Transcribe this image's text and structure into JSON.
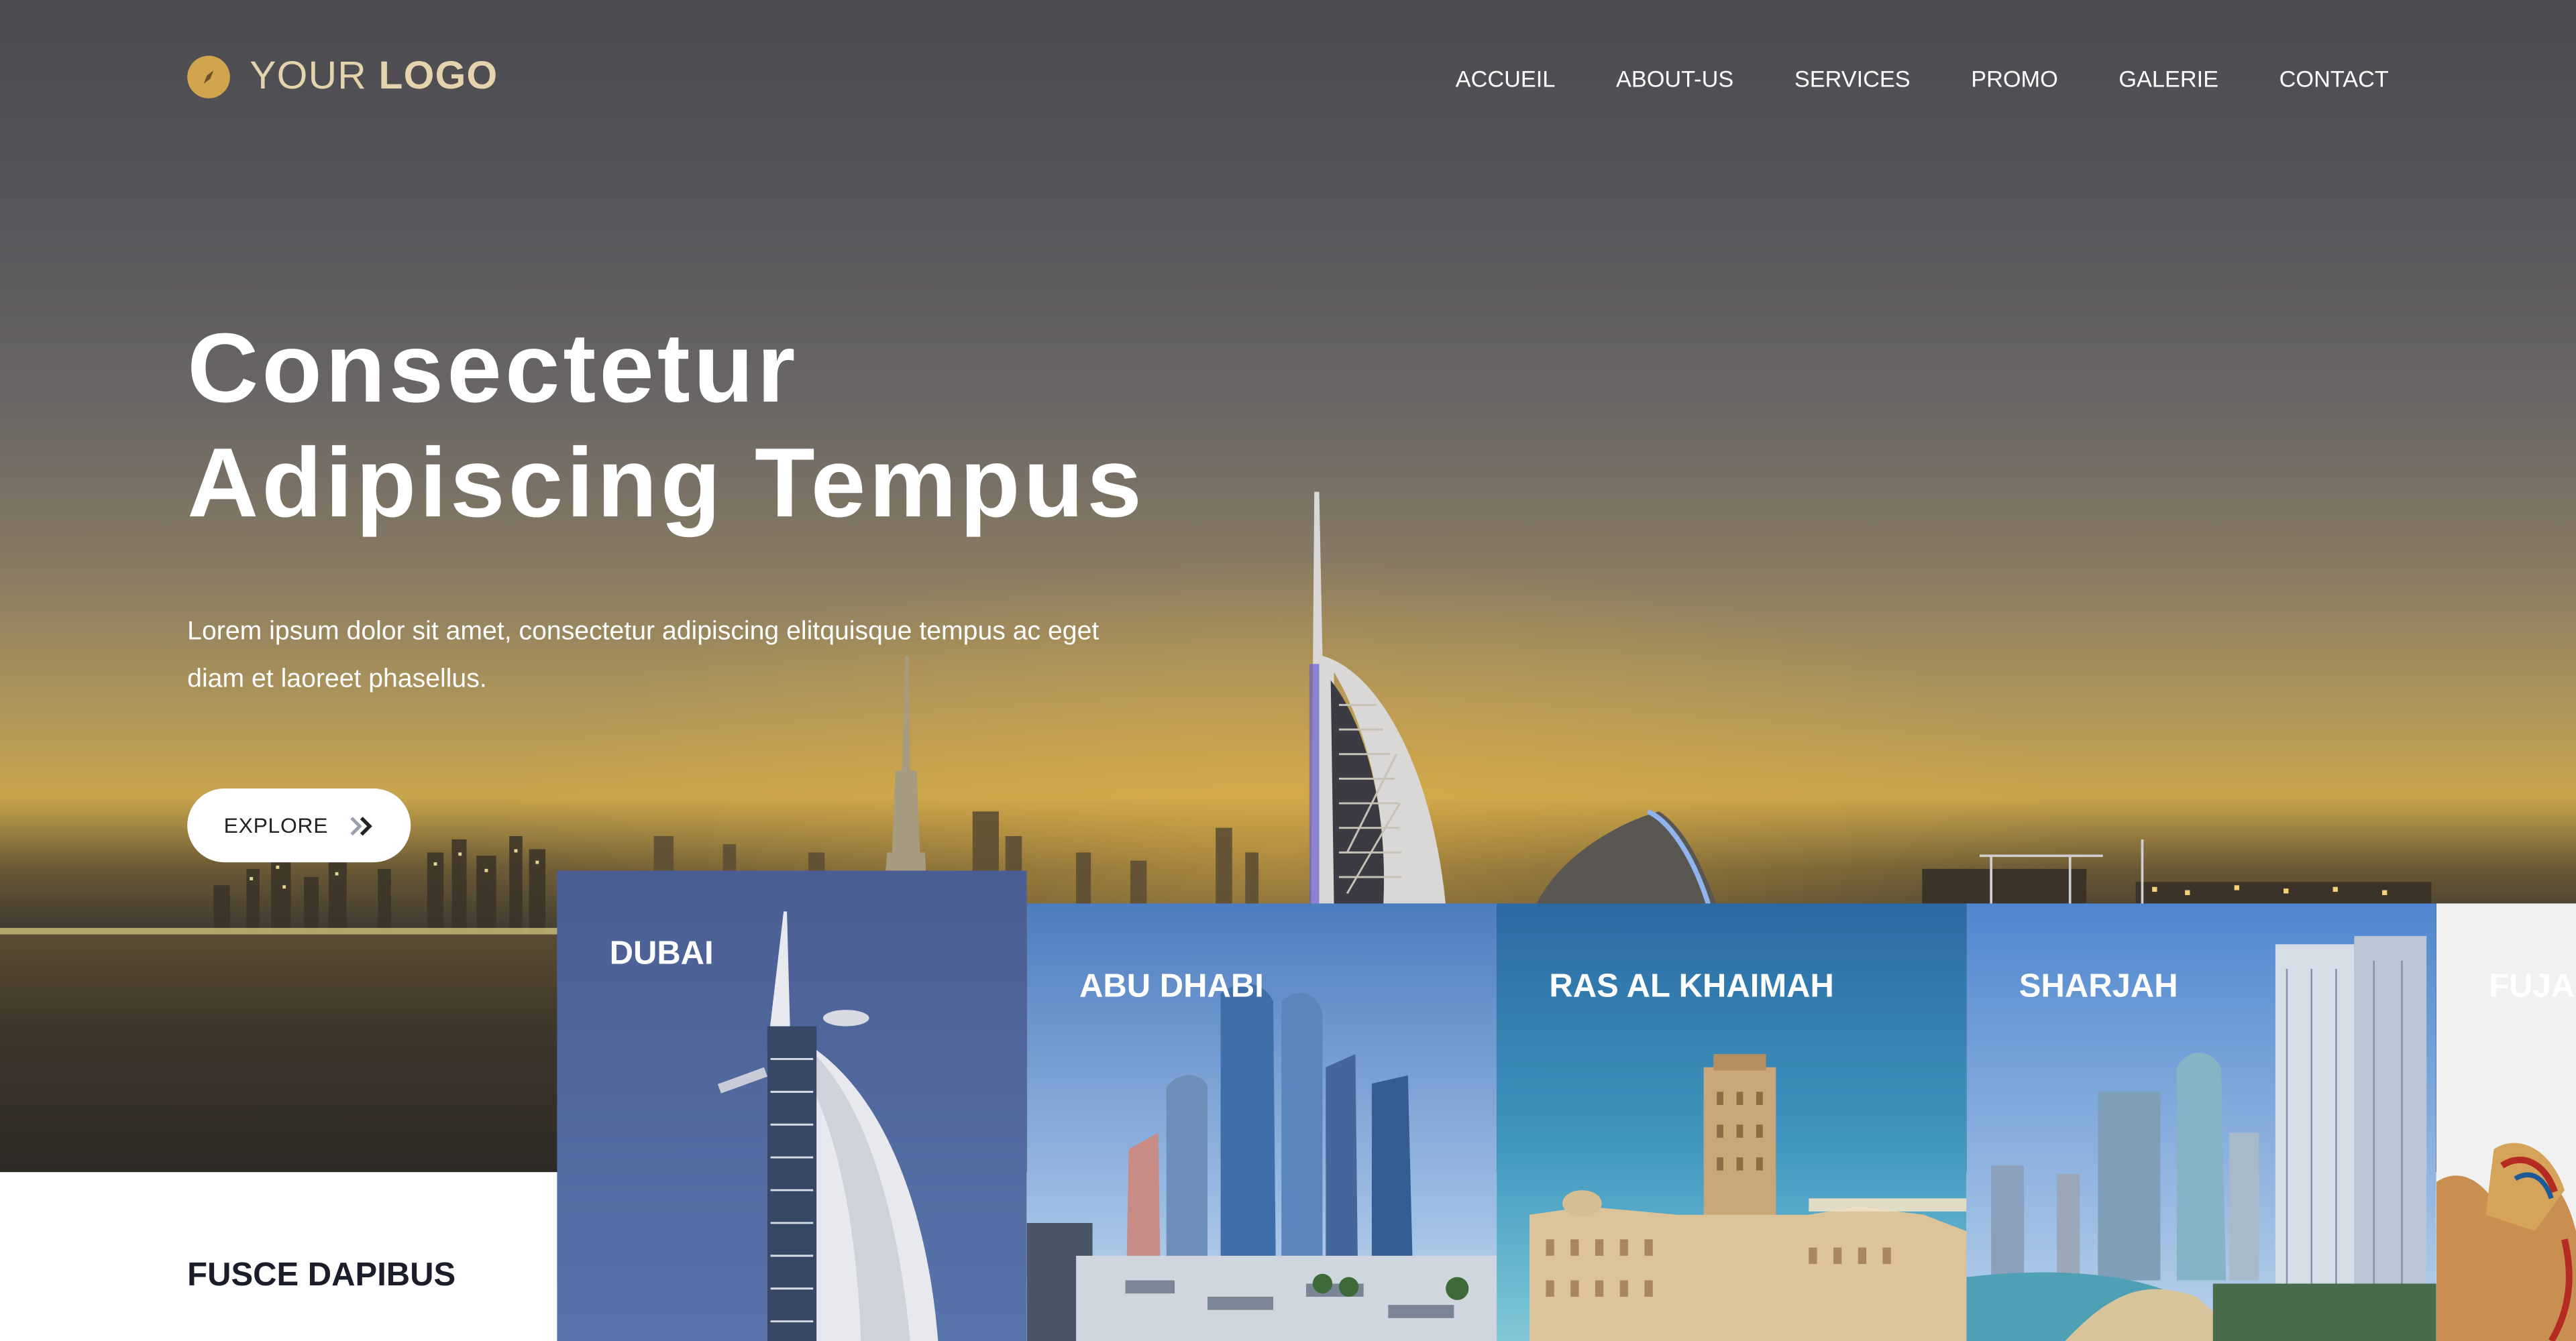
{
  "logo": {
    "icon": "compass-icon",
    "text_light": "YOUR ",
    "text_bold": "LOGO",
    "accent_color": "#d1a54e"
  },
  "nav": {
    "items": [
      "ACCUEIL",
      "ABOUT-US",
      "SERVICES",
      "PROMO",
      "GALERIE",
      "CONTACT"
    ]
  },
  "hero": {
    "title_line1": "Consectetur",
    "title_line2": "Adipiscing Tempus",
    "text": "Lorem ipsum dolor sit amet, consectetur adipiscing elitquisque tempus ac eget diam et laoreet phasellus.",
    "button_label": "EXPLORE",
    "button_icon": "double-chevron-right-icon"
  },
  "section": {
    "title": "FUSCE DAPIBUS"
  },
  "cities": [
    {
      "name": "DUBAI"
    },
    {
      "name": "ABU DHABI"
    },
    {
      "name": "RAS AL KHAIMAH"
    },
    {
      "name": "SHARJAH"
    },
    {
      "name": "FUJAIRAH"
    }
  ]
}
